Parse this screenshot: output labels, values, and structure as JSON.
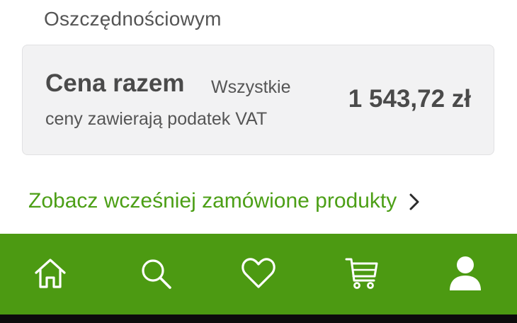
{
  "page": {
    "heading_partial": "Oszczędnościowym"
  },
  "summary": {
    "total_label": "Cena razem",
    "vat_note_line1": "Wszystkie",
    "vat_note_line2": "ceny zawierają podatek VAT",
    "total_value": "1 543,72 zł"
  },
  "links": {
    "previous_orders": "Zobacz wcześniej zamówione produkty",
    "previous_orders_icon": "chevron-right-icon"
  },
  "bottom_nav": {
    "background": "#4c9a12",
    "items": [
      {
        "icon": "home-icon",
        "active": false
      },
      {
        "icon": "search-icon",
        "active": false
      },
      {
        "icon": "heart-icon",
        "active": false
      },
      {
        "icon": "cart-icon",
        "active": false
      },
      {
        "icon": "user-icon",
        "active": true
      }
    ]
  },
  "colors": {
    "brand_green": "#4c9a12",
    "link_green": "#4c9f16",
    "text_dark": "#4a4a4a",
    "card_bg": "#f2f2f3"
  }
}
